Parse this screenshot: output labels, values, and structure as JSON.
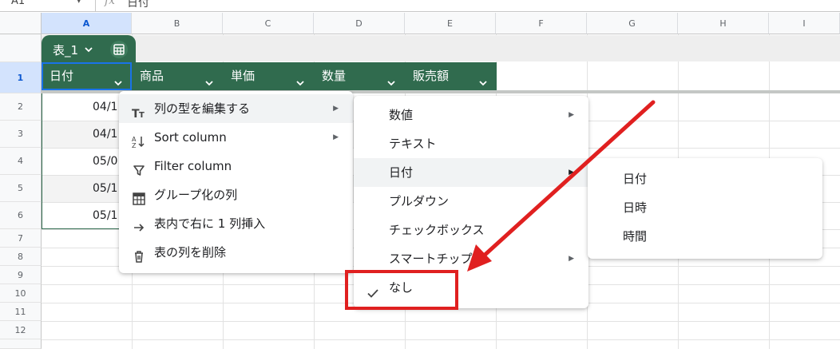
{
  "formula_bar": {
    "cell_ref": "A1",
    "value": "日付"
  },
  "columns": [
    "A",
    "B",
    "C",
    "D",
    "E",
    "F",
    "G",
    "H",
    "I"
  ],
  "rows": [
    "1",
    "2",
    "3",
    "4",
    "5",
    "6",
    "7",
    "8",
    "9",
    "10",
    "11",
    "12"
  ],
  "table": {
    "name": "表_1",
    "headers": [
      "日付",
      "商品",
      "単価",
      "数量",
      "販売額"
    ],
    "date_cells": [
      "04/1",
      "04/1",
      "05/0",
      "05/1",
      "05/1"
    ]
  },
  "menu": {
    "items": [
      {
        "label": "列の型を編集する",
        "icon": "text-type-icon",
        "submenu": true
      },
      {
        "label": "Sort column",
        "icon": "sort-az-icon",
        "submenu": true
      },
      {
        "label": "Filter column",
        "icon": "filter-icon",
        "submenu": false
      },
      {
        "label": "グループ化の列",
        "icon": "table-group-icon",
        "submenu": false
      },
      {
        "label": "表内で右に 1 列挿入",
        "icon": "arrow-right-icon",
        "submenu": false
      },
      {
        "label": "表の列を削除",
        "icon": "trash-icon",
        "submenu": false
      }
    ]
  },
  "type_menu": {
    "items": [
      {
        "label": "数値",
        "submenu": true
      },
      {
        "label": "テキスト",
        "submenu": false
      },
      {
        "label": "日付",
        "submenu": true
      },
      {
        "label": "プルダウン",
        "submenu": false
      },
      {
        "label": "チェックボックス",
        "submenu": false
      },
      {
        "label": "スマートチップ",
        "submenu": true
      },
      {
        "label": "なし",
        "submenu": false,
        "checked": true
      }
    ]
  },
  "date_menu": {
    "items": [
      {
        "label": "日付"
      },
      {
        "label": "日時"
      },
      {
        "label": "時間"
      }
    ]
  },
  "colors": {
    "table_green": "#306b4e",
    "highlight_red": "#e02020",
    "selection_blue": "#d3e3fd"
  }
}
